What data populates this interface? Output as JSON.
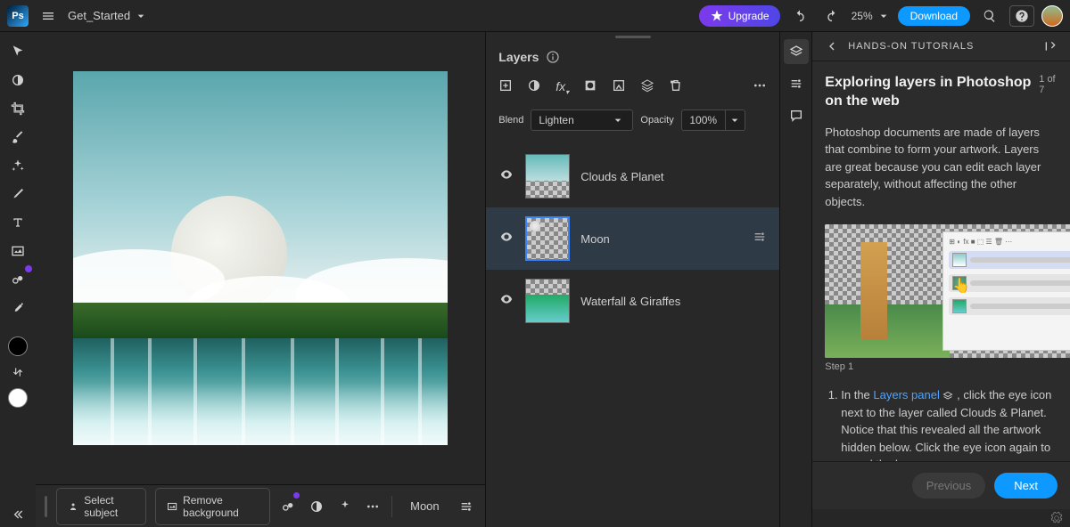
{
  "topbar": {
    "filename": "Get_Started",
    "upgrade_label": "Upgrade",
    "zoom": "25%",
    "download_label": "Download"
  },
  "context_bar": {
    "select_subject": "Select subject",
    "remove_bg": "Remove background",
    "active_layer": "Moon"
  },
  "layers_panel": {
    "title": "Layers",
    "blend_label": "Blend",
    "blend_value": "Lighten",
    "opacity_label": "Opacity",
    "opacity_value": "100%",
    "layers": [
      {
        "name": "Clouds & Planet",
        "visible": true,
        "selected": false
      },
      {
        "name": "Moon",
        "visible": true,
        "selected": true
      },
      {
        "name": "Waterfall & Giraffes",
        "visible": true,
        "selected": false
      }
    ]
  },
  "tutorial": {
    "breadcrumb": "HANDS-ON TUTORIALS",
    "title": "Exploring layers in Photoshop on the web",
    "step_counter": "1 of 7",
    "description": "Photoshop documents are made of layers that combine to form your artwork. Layers are great because you can edit each layer separately, without affecting the other objects.",
    "img_caption": "Step 1",
    "instruction_prefix": "In the ",
    "instruction_link": "Layers panel",
    "instruction_suffix": " , click the eye icon next to the layer called Clouds & Planet. Notice that this revealed all the artwork hidden below. Click the eye icon again to reveal the layer.",
    "prev_label": "Previous",
    "next_label": "Next"
  }
}
